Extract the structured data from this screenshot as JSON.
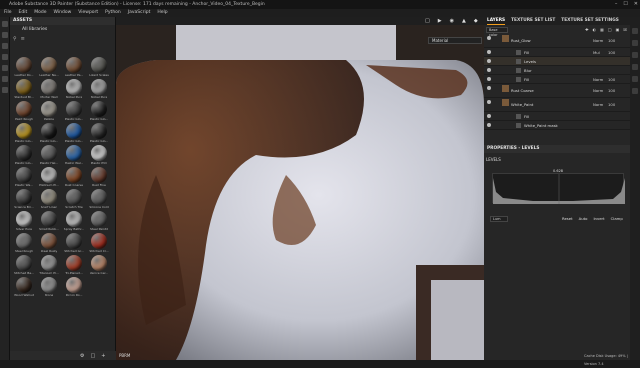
{
  "window": {
    "title": "Adobe Substance 3D Painter (Substance Edition) - License: 171 days remaining - Anchor_Video_04_Texture_Begin",
    "controls": [
      "–",
      "☐",
      "✕"
    ]
  },
  "menu": [
    "File",
    "Edit",
    "Mode",
    "Window",
    "Viewport",
    "Python",
    "JavaScript",
    "Help"
  ],
  "assets": {
    "header": "ASSETS",
    "library": "All libraries",
    "materials": [
      {
        "label": "Leather Ro...",
        "color": "#6b4a35"
      },
      {
        "label": "Leather Na...",
        "color": "#8a6a4d"
      },
      {
        "label": "Leather Pa...",
        "color": "#7a5236"
      },
      {
        "label": "Lizard Scales",
        "color": "#5a5a55"
      },
      {
        "label": "Stardust Bl...",
        "color": "#8c6a1a"
      },
      {
        "label": "Mortar Wall",
        "color": "#8a8580"
      },
      {
        "label": "Nickel Pure",
        "color": "#c8c8c8"
      },
      {
        "label": "Nickel Pure",
        "color": "#b0b0b0"
      },
      {
        "label": "Paint Rough",
        "color": "#7a4a30"
      },
      {
        "label": "Pebble",
        "color": "#aaa59a"
      },
      {
        "label": "Plastic Glo...",
        "color": "#404040"
      },
      {
        "label": "Plastic Glo...",
        "color": "#202020"
      },
      {
        "label": "Plastic Glo...",
        "color": "#c8a020"
      },
      {
        "label": "Plastic Glo...",
        "color": "#1a1a1a"
      },
      {
        "label": "Plastic Glo...",
        "color": "#1e5fb0"
      },
      {
        "label": "Plastic Glo...",
        "color": "#2a2a2a"
      },
      {
        "label": "Plastic Glo...",
        "color": "#303030"
      },
      {
        "label": "Plastic Hel...",
        "color": "#5a5a5a"
      },
      {
        "label": "Plastic Wal...",
        "color": "#2a6ab5"
      },
      {
        "label": "Plastic PVC",
        "color": "#e0e0e0"
      },
      {
        "label": "Plastic Wa...",
        "color": "#454545"
      },
      {
        "label": "Platinum Pl...",
        "color": "#d0d0d0"
      },
      {
        "label": "Rust Coarse",
        "color": "#8a4a25"
      },
      {
        "label": "Rust Fine",
        "color": "#704030"
      },
      {
        "label": "Science Bri...",
        "color": "#3a3a3a"
      },
      {
        "label": "Scarf Linen",
        "color": "#a09a8a"
      },
      {
        "label": "Scratch Tile",
        "color": "#5a5a5a"
      },
      {
        "label": "Silicone Cold",
        "color": "#606060"
      },
      {
        "label": "Silver Pure",
        "color": "#dcdcdc"
      },
      {
        "label": "Small Rubb...",
        "color": "#4a4a4a"
      },
      {
        "label": "Spray Bathr...",
        "color": "#cfcfcf"
      },
      {
        "label": "Steel Paintd",
        "color": "#6a6a6a"
      },
      {
        "label": "Steel Rough",
        "color": "#707070"
      },
      {
        "label": "Steel Rusty",
        "color": "#8a5a40"
      },
      {
        "label": "Stitched Gr...",
        "color": "#4a4a4a"
      },
      {
        "label": "Stitched Cr...",
        "color": "#b03020"
      },
      {
        "label": "Stitched Be...",
        "color": "#505050"
      },
      {
        "label": "Titanium Pl...",
        "color": "#a0a0a0"
      },
      {
        "label": "Tri-Planed...",
        "color": "#b04028"
      },
      {
        "label": "Venice Cer...",
        "color": "#c89070"
      },
      {
        "label": "Wood Walnut",
        "color": "#3a2a20"
      },
      {
        "label": "Stone",
        "color": "#9a9a9a"
      },
      {
        "label": "Zircon Ro...",
        "color": "#d8b0a0"
      }
    ]
  },
  "viewport": {
    "mode": "Material",
    "footer": "PBRM"
  },
  "right": {
    "tabs": [
      "LAYERS",
      "TEXTURE SET LIST",
      "TEXTURE SET SETTINGS"
    ],
    "blend_select": "Base color",
    "layers": [
      {
        "name": "Rust_Glow",
        "blend": "Norm",
        "opacity": "100",
        "level": 0,
        "selected": false,
        "big": true
      },
      {
        "name": "Fill",
        "blend": "Mul",
        "opacity": "100",
        "level": 1,
        "selected": false,
        "big": false
      },
      {
        "name": "Levels",
        "blend": "",
        "opacity": "",
        "level": 1,
        "selected": true,
        "big": false
      },
      {
        "name": "Blur",
        "blend": "",
        "opacity": "",
        "level": 1,
        "selected": false,
        "big": false
      },
      {
        "name": "Fill",
        "blend": "Norm",
        "opacity": "100",
        "level": 1,
        "selected": false,
        "big": false
      },
      {
        "name": "Rust Coarse",
        "blend": "Norm",
        "opacity": "100",
        "level": 0,
        "selected": false,
        "big": true
      },
      {
        "name": "White_Paint",
        "blend": "Norm",
        "opacity": "100",
        "level": 0,
        "selected": false,
        "big": true
      },
      {
        "name": "Fill",
        "blend": "",
        "opacity": "",
        "level": 1,
        "selected": false,
        "big": false
      },
      {
        "name": "White_Paint mask",
        "blend": "",
        "opacity": "",
        "level": 1,
        "selected": false,
        "big": false
      }
    ],
    "properties_title": "PROPERTIES - LEVELS",
    "levels_label": "LEVELS",
    "level_value": "0.628",
    "channel": "Lum",
    "buttons": [
      "Reset",
      "Auto",
      "Invert",
      "Clamp"
    ],
    "status": "Cache Disk Usage: 49% | Version 7.4"
  },
  "colors": {
    "accent": "#f29e1d"
  }
}
